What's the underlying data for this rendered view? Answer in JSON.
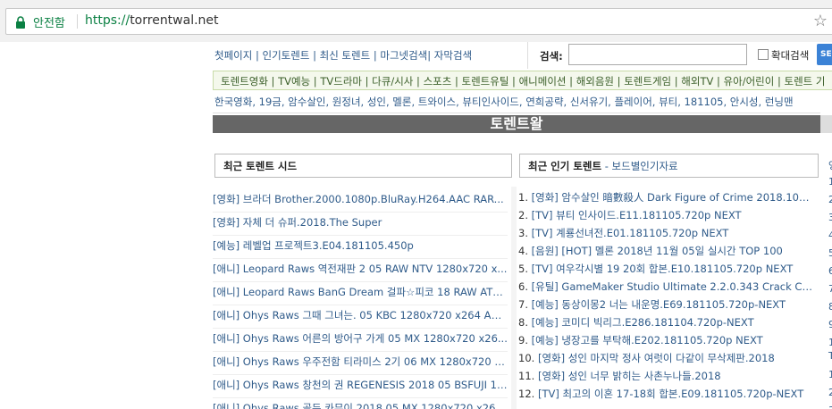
{
  "browser": {
    "secure_label": "안전함",
    "url_scheme": "https://",
    "url_host": "torrentwal.net"
  },
  "topnav": [
    "첫페이지",
    "인기토렌트",
    "최신 토렌트",
    "마그넷검색",
    "자막검색"
  ],
  "search": {
    "label": "검색:",
    "value": "",
    "expand_label": "확대검색",
    "button_label": "SE"
  },
  "categories": [
    "토렌트영화",
    "TV예능",
    "TV드라마",
    "다큐/시사",
    "스포츠",
    "토렌트유틸",
    "애니메이션",
    "해외음원",
    "토렌트게임",
    "해외TV",
    "유아/어린이",
    "토렌트 기"
  ],
  "tags": "한국영화, 19금, 암수살인, 원정녀, 성인, 멜론, 트와이스, 뷰티인사이드, 연희공략, 신서유기, 플레이어, 뷰티, 181105, 안시성, 런닝맨",
  "banner": "토렌트왈",
  "recent_title": "최근 토렌트 시드",
  "popular_title": "최근 인기 토렌트",
  "popular_sub": " - 보드별인기자료",
  "recent_items": [
    "[영화] 브라더 Brother.2000.1080p.BluRay.H264.AAC RAR...",
    "[영화] 자체 더 슈퍼.2018.The Super",
    "[예능] 레벨업 프로젝트3.E04.181105.450p",
    "[애니] Leopard Raws 역전재판 2 05 RAW NTV 1280x720 x...",
    "[애니] Leopard Raws BanG Dream 걸파☆피코 18 RAW ATX...",
    "[애니] Ohys Raws 그때 그녀는. 05 KBC 1280x720 x264 AA...",
    "[애니] Ohys Raws 어른의 방어구 가게 05 MX 1280x720 x26...",
    "[애니] Ohys Raws 우주전함 티라미스 2기 06 MX 1280x720 x...",
    "[애니] Ohys Raws 창천의 권 REGENESIS 2018 05 BSFUJI 12...",
    "[애니] Ohys Raws 골든 카무이 2018 05 MX 1280x720 x26..."
  ],
  "popular_items": [
    "[영화] 암수살인 暗數殺人 Dark Figure of Crime 2018.108...",
    "[TV] 뷰티 인사이드.E11.181105.720p NEXT",
    "[TV] 계룡선녀전.E01.181105.720p NEXT",
    "[음원] [HOT] 멜론 2018년 11월 05일 실시간 TOP 100",
    "[TV] 여우각시별 19 20회 합본.E10.181105.720p NEXT",
    "[유틸] GameMaker Studio Ultimate 2.2.0.343 Crack Cra...",
    "[예능] 동상이몽2 너는 내운명.E69.181105.720p-NEXT",
    "[예능] 코미디 빅리그.E286.181104.720p-NEXT",
    "[예능] 냉장고를 부탁해.E202.181105.720p NEXT",
    "[영화] 성인 마지막 정사 여럿이 다같이 무삭제판.2018",
    "[영화] 성인 너무 밝히는 사촌누나들.2018",
    "[TV] 최고의 이혼 17-18회 합본.E09.181105.720p-NEXT"
  ],
  "right_edge": [
    "영",
    "1",
    "2",
    "3",
    "4",
    "5",
    "6",
    "7",
    "8",
    "9",
    "1",
    "T",
    "1",
    "2",
    "3"
  ]
}
